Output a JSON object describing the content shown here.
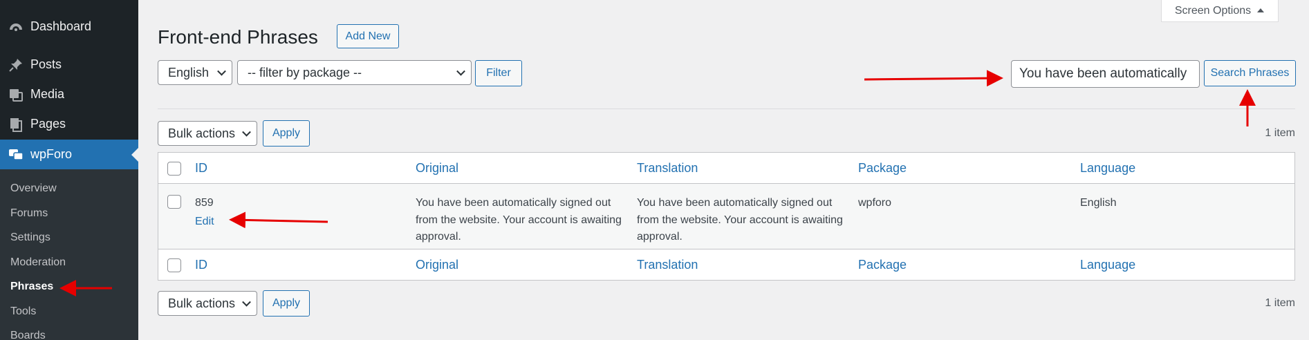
{
  "sidebar": {
    "items": [
      {
        "label": "Dashboard",
        "icon": "dashboard-icon"
      },
      {
        "label": "Posts",
        "icon": "pin-icon"
      },
      {
        "label": "Media",
        "icon": "media-icon"
      },
      {
        "label": "Pages",
        "icon": "pages-icon"
      },
      {
        "label": "wpForo",
        "icon": "forum-icon"
      }
    ],
    "submenu": [
      "Overview",
      "Forums",
      "Settings",
      "Moderation",
      "Phrases",
      "Tools",
      "Boards"
    ]
  },
  "screen_options": {
    "label": "Screen Options",
    "icon": "caret-up-icon"
  },
  "page": {
    "title": "Front-end Phrases",
    "add_new": "Add New"
  },
  "filters": {
    "language": "English",
    "package": "-- filter by package --",
    "filter_button": "Filter"
  },
  "search": {
    "value": "You have been automatically",
    "button": "Search Phrases"
  },
  "bulk": {
    "label": "Bulk actions",
    "apply": "Apply",
    "count": "1 item"
  },
  "table": {
    "columns": [
      "ID",
      "Original",
      "Translation",
      "Package",
      "Language"
    ],
    "rows": [
      {
        "id": "859",
        "action": "Edit",
        "original": "You have been automatically signed out from the website. Your account is awaiting approval.",
        "translation": "You have been automatically signed out from the website. Your account is awaiting approval.",
        "package": "wpforo",
        "language": "English"
      }
    ]
  },
  "colors": {
    "accent": "#2271b1",
    "sidebar": "#1d2327",
    "annotation": "#e60000"
  }
}
